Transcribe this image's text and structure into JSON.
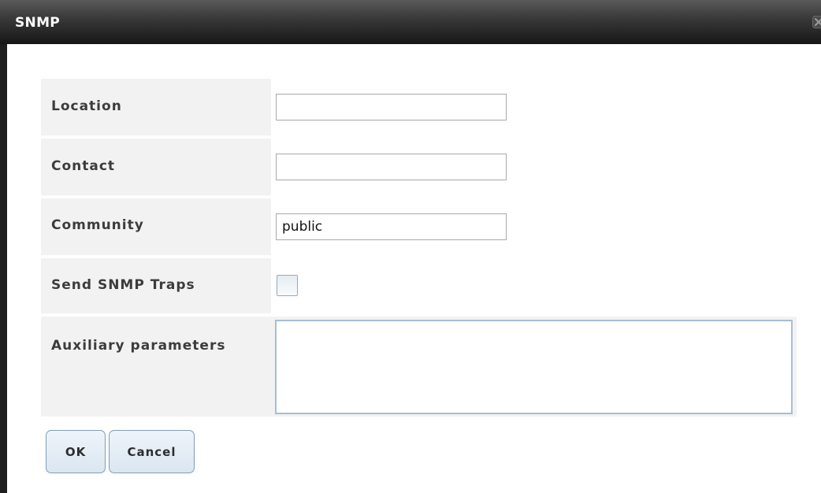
{
  "dialog": {
    "title": "SNMP",
    "close_icon": "close-icon"
  },
  "form": {
    "location": {
      "label": "Location",
      "value": ""
    },
    "contact": {
      "label": "Contact",
      "value": ""
    },
    "community": {
      "label": "Community",
      "value": "public"
    },
    "send_traps": {
      "label": "Send SNMP Traps",
      "checked": false
    },
    "aux_params": {
      "label": "Auxiliary parameters",
      "value": ""
    }
  },
  "buttons": {
    "ok_label": "OK",
    "cancel_label": "Cancel"
  },
  "colors": {
    "titlebar_dark": "#161616",
    "label_bg": "#f2f2f2",
    "button_border": "#7f9db9",
    "button_bg": "#dbe6f1"
  }
}
